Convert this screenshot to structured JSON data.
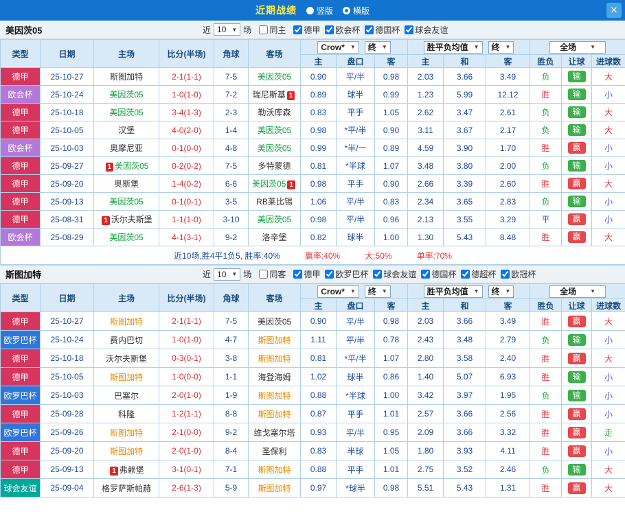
{
  "titlebar": {
    "title": "近期战绩",
    "radio_vertical": "竖版",
    "radio_horizontal": "横版",
    "selected_key": "radio_horizontal",
    "close_label": "✕"
  },
  "colors": {
    "accent_blue": "#1374d0",
    "league_colors": {
      "德甲": "#d6365e",
      "欧会杯": "#b478d8",
      "欧罗巴杯": "#3076d8",
      "球会友谊": "#00a79b"
    },
    "result": {
      "win": "#e5383d",
      "lose": "#1fa63c",
      "draw": "#3b5bd5",
      "push": "#1fa63c"
    },
    "handicap_badge": {
      "win": "#e5484d",
      "lose": "#3cb04c"
    },
    "goals": {
      "big": "#e5383d",
      "small": "#3b5bd5",
      "push": "#1fa63c"
    },
    "score_text": "#e02b2b",
    "odds_text": "#1a4a9e",
    "opponent_text": "#333333"
  },
  "sections": [
    {
      "team": "美因茨05",
      "team_color": "#09a23a",
      "filter": {
        "near_label": "近",
        "games_value": "10",
        "games_suffix": "场",
        "same_label": "同主",
        "same_checked": false,
        "leagues": [
          {
            "label": "德甲",
            "checked": true
          },
          {
            "label": "欧会杯",
            "checked": true
          },
          {
            "label": "德国杯",
            "checked": true
          },
          {
            "label": "球会友谊",
            "checked": true
          }
        ]
      },
      "header": {
        "type": "类型",
        "date": "日期",
        "home": "主场",
        "score": "比分(半场)",
        "corner": "角球",
        "away": "客场",
        "odds_source": "Crow*",
        "final1": "终",
        "col_home": "主",
        "col_handicap": "盘口",
        "col_away": "客",
        "euro_avg": "胜平负均值",
        "final2": "终",
        "col_win": "主",
        "col_draw": "和",
        "col_lose": "客",
        "scope": "全场",
        "col_result": "胜负",
        "col_hresult": "让球",
        "col_goals": "进球数"
      },
      "rows": [
        {
          "league": "德甲",
          "date": "25-10-27",
          "home": {
            "name": "斯图加特",
            "self": false
          },
          "score": "2-1(1-1)",
          "corner": "7-5",
          "away": {
            "name": "美因茨05",
            "self": true
          },
          "odds": [
            "0.90",
            "平/半",
            "0.98"
          ],
          "euro": [
            "2.03",
            "3.66",
            "3.49"
          ],
          "result": {
            "text": "负",
            "style": "lose"
          },
          "handicap": {
            "text": "输",
            "style": "lose"
          },
          "goals": {
            "text": "大",
            "style": "big"
          }
        },
        {
          "league": "欧会杯",
          "date": "25-10-24",
          "home": {
            "name": "美因茨05",
            "self": true
          },
          "score": "1-0(1-0)",
          "corner": "7-2",
          "away": {
            "name": "瑞尼斯基",
            "self": false,
            "card_after": "1"
          },
          "odds": [
            "0.89",
            "球半",
            "0.99"
          ],
          "euro": [
            "1.23",
            "5.99",
            "12.12"
          ],
          "result": {
            "text": "胜",
            "style": "win"
          },
          "handicap": {
            "text": "输",
            "style": "lose"
          },
          "goals": {
            "text": "小",
            "style": "small"
          }
        },
        {
          "league": "德甲",
          "date": "25-10-18",
          "home": {
            "name": "美因茨05",
            "self": true
          },
          "score": "3-4(1-3)",
          "corner": "2-3",
          "away": {
            "name": "勒沃库森",
            "self": false
          },
          "odds": [
            "0.83",
            "平手",
            "1.05"
          ],
          "euro": [
            "2.62",
            "3.47",
            "2.61"
          ],
          "result": {
            "text": "负",
            "style": "lose"
          },
          "handicap": {
            "text": "输",
            "style": "lose"
          },
          "goals": {
            "text": "大",
            "style": "big"
          }
        },
        {
          "league": "德甲",
          "date": "25-10-05",
          "home": {
            "name": "汉堡",
            "self": false
          },
          "score": "4-0(2-0)",
          "corner": "1-4",
          "away": {
            "name": "美因茨05",
            "self": true
          },
          "odds": [
            "0.98",
            "*平/半",
            "0.90"
          ],
          "euro": [
            "3.11",
            "3.67",
            "2.17"
          ],
          "result": {
            "text": "负",
            "style": "lose"
          },
          "handicap": {
            "text": "输",
            "style": "lose"
          },
          "goals": {
            "text": "大",
            "style": "big"
          }
        },
        {
          "league": "欧会杯",
          "date": "25-10-03",
          "home": {
            "name": "奥摩尼亚",
            "self": false
          },
          "score": "0-1(0-0)",
          "corner": "4-8",
          "away": {
            "name": "美因茨05",
            "self": true
          },
          "odds": [
            "0.99",
            "*半/一",
            "0.89"
          ],
          "euro": [
            "4.59",
            "3.90",
            "1.70"
          ],
          "result": {
            "text": "胜",
            "style": "win"
          },
          "handicap": {
            "text": "赢",
            "style": "win"
          },
          "goals": {
            "text": "小",
            "style": "small"
          }
        },
        {
          "league": "德甲",
          "date": "25-09-27",
          "home": {
            "name": "美因茨05",
            "self": true,
            "card_before": "1"
          },
          "score": "0-2(0-2)",
          "corner": "7-5",
          "away": {
            "name": "多特蒙德",
            "self": false
          },
          "odds": [
            "0.81",
            "*半球",
            "1.07"
          ],
          "euro": [
            "3.48",
            "3.80",
            "2.00"
          ],
          "result": {
            "text": "负",
            "style": "lose"
          },
          "handicap": {
            "text": "输",
            "style": "lose"
          },
          "goals": {
            "text": "小",
            "style": "small"
          }
        },
        {
          "league": "德甲",
          "date": "25-09-20",
          "home": {
            "name": "奥斯堡",
            "self": false
          },
          "score": "1-4(0-2)",
          "corner": "6-6",
          "away": {
            "name": "美因茨05",
            "self": true,
            "card_after": "1"
          },
          "odds": [
            "0.98",
            "平手",
            "0.90"
          ],
          "euro": [
            "2.66",
            "3.39",
            "2.60"
          ],
          "result": {
            "text": "胜",
            "style": "win"
          },
          "handicap": {
            "text": "赢",
            "style": "win"
          },
          "goals": {
            "text": "大",
            "style": "big"
          }
        },
        {
          "league": "德甲",
          "date": "25-09-13",
          "home": {
            "name": "美因茨05",
            "self": true
          },
          "score": "0-1(0-1)",
          "corner": "3-5",
          "away": {
            "name": "RB莱比锡",
            "self": false
          },
          "odds": [
            "1.06",
            "平/半",
            "0.83"
          ],
          "euro": [
            "2.34",
            "3.65",
            "2.83"
          ],
          "result": {
            "text": "负",
            "style": "lose"
          },
          "handicap": {
            "text": "输",
            "style": "lose"
          },
          "goals": {
            "text": "小",
            "style": "small"
          }
        },
        {
          "league": "德甲",
          "date": "25-08-31",
          "home": {
            "name": "沃尔夫斯堡",
            "self": false,
            "card_before": "1"
          },
          "score": "1-1(1-0)",
          "corner": "3-10",
          "away": {
            "name": "美因茨05",
            "self": true
          },
          "odds": [
            "0.98",
            "平/半",
            "0.96"
          ],
          "euro": [
            "2.13",
            "3.55",
            "3.29"
          ],
          "result": {
            "text": "平",
            "style": "draw"
          },
          "handicap": {
            "text": "赢",
            "style": "win"
          },
          "goals": {
            "text": "小",
            "style": "small"
          }
        },
        {
          "league": "欧会杯",
          "date": "25-08-29",
          "home": {
            "name": "美因茨05",
            "self": true
          },
          "score": "4-1(3-1)",
          "corner": "9-2",
          "away": {
            "name": "洛辛堡",
            "self": false
          },
          "odds": [
            "0.82",
            "球半",
            "1.00"
          ],
          "euro": [
            "1.30",
            "5.43",
            "8.48"
          ],
          "result": {
            "text": "胜",
            "style": "win"
          },
          "handicap": {
            "text": "赢",
            "style": "win"
          },
          "goals": {
            "text": "大",
            "style": "big"
          }
        }
      ],
      "summary": [
        {
          "text": "近10场,胜4平1负5, 胜率:40%",
          "color": "#1a4a9e"
        },
        {
          "text": "赢率:40%",
          "color": "#e5383d"
        },
        {
          "text": "大:50%",
          "color": "#e5383d"
        },
        {
          "text": "单率:70%",
          "color": "#e5383d"
        }
      ]
    },
    {
      "team": "斯图加特",
      "team_color": "#ef8a00",
      "filter": {
        "near_label": "近",
        "games_value": "10",
        "games_suffix": "场",
        "same_label": "同客",
        "same_checked": false,
        "leagues": [
          {
            "label": "德甲",
            "checked": true
          },
          {
            "label": "欧罗巴杯",
            "checked": true
          },
          {
            "label": "球会友谊",
            "checked": true
          },
          {
            "label": "德国杯",
            "checked": true
          },
          {
            "label": "德超杯",
            "checked": true
          },
          {
            "label": "欧冠杯",
            "checked": true
          }
        ]
      },
      "header": {
        "type": "类型",
        "date": "日期",
        "home": "主场",
        "score": "比分(半场)",
        "corner": "角球",
        "away": "客场",
        "odds_source": "Crow*",
        "final1": "终",
        "col_home": "主",
        "col_handicap": "盘口",
        "col_away": "客",
        "euro_avg": "胜平负均值",
        "final2": "终",
        "col_win": "主",
        "col_draw": "和",
        "col_lose": "客",
        "scope": "全场",
        "col_result": "胜负",
        "col_hresult": "让球",
        "col_goals": "进球数"
      },
      "rows": [
        {
          "league": "德甲",
          "date": "25-10-27",
          "home": {
            "name": "斯图加特",
            "self": true
          },
          "score": "2-1(1-1)",
          "corner": "7-5",
          "away": {
            "name": "美因茨05",
            "self": false
          },
          "odds": [
            "0.90",
            "平/半",
            "0.98"
          ],
          "euro": [
            "2.03",
            "3.66",
            "3.49"
          ],
          "result": {
            "text": "胜",
            "style": "win"
          },
          "handicap": {
            "text": "赢",
            "style": "win"
          },
          "goals": {
            "text": "大",
            "style": "big"
          }
        },
        {
          "league": "欧罗巴杯",
          "date": "25-10-24",
          "home": {
            "name": "费内巴切",
            "self": false
          },
          "score": "1-0(1-0)",
          "corner": "4-7",
          "away": {
            "name": "斯图加特",
            "self": true
          },
          "odds": [
            "1.11",
            "平/半",
            "0.78"
          ],
          "euro": [
            "2.43",
            "3.48",
            "2.79"
          ],
          "result": {
            "text": "负",
            "style": "lose"
          },
          "handicap": {
            "text": "输",
            "style": "lose"
          },
          "goals": {
            "text": "小",
            "style": "small"
          }
        },
        {
          "league": "德甲",
          "date": "25-10-18",
          "home": {
            "name": "沃尔夫斯堡",
            "self": false
          },
          "score": "0-3(0-1)",
          "corner": "3-8",
          "away": {
            "name": "斯图加特",
            "self": true
          },
          "odds": [
            "0.81",
            "*平/半",
            "1.07"
          ],
          "euro": [
            "2.80",
            "3.58",
            "2.40"
          ],
          "result": {
            "text": "胜",
            "style": "win"
          },
          "handicap": {
            "text": "赢",
            "style": "win"
          },
          "goals": {
            "text": "大",
            "style": "big"
          }
        },
        {
          "league": "德甲",
          "date": "25-10-05",
          "home": {
            "name": "斯图加特",
            "self": true
          },
          "score": "1-0(0-0)",
          "corner": "1-1",
          "away": {
            "name": "海登海姆",
            "self": false
          },
          "odds": [
            "1.02",
            "球半",
            "0.86"
          ],
          "euro": [
            "1.40",
            "5.07",
            "6.93"
          ],
          "result": {
            "text": "胜",
            "style": "win"
          },
          "handicap": {
            "text": "输",
            "style": "lose"
          },
          "goals": {
            "text": "小",
            "style": "small"
          }
        },
        {
          "league": "欧罗巴杯",
          "date": "25-10-03",
          "home": {
            "name": "巴塞尔",
            "self": false
          },
          "score": "2-0(1-0)",
          "corner": "1-9",
          "away": {
            "name": "斯图加特",
            "self": true
          },
          "odds": [
            "0.88",
            "*半球",
            "1.00"
          ],
          "euro": [
            "3.42",
            "3.97",
            "1.95"
          ],
          "result": {
            "text": "负",
            "style": "lose"
          },
          "handicap": {
            "text": "输",
            "style": "lose"
          },
          "goals": {
            "text": "小",
            "style": "small"
          }
        },
        {
          "league": "德甲",
          "date": "25-09-28",
          "home": {
            "name": "科隆",
            "self": false
          },
          "score": "1-2(1-1)",
          "corner": "8-8",
          "away": {
            "name": "斯图加特",
            "self": true
          },
          "odds": [
            "0.87",
            "平手",
            "1.01"
          ],
          "euro": [
            "2.57",
            "3.66",
            "2.56"
          ],
          "result": {
            "text": "胜",
            "style": "win"
          },
          "handicap": {
            "text": "赢",
            "style": "win"
          },
          "goals": {
            "text": "小",
            "style": "small"
          }
        },
        {
          "league": "欧罗巴杯",
          "date": "25-09-26",
          "home": {
            "name": "斯图加特",
            "self": true
          },
          "score": "2-1(0-0)",
          "corner": "9-2",
          "away": {
            "name": "维戈塞尔塔",
            "self": false
          },
          "odds": [
            "0.93",
            "平/半",
            "0.95"
          ],
          "euro": [
            "2.09",
            "3.66",
            "3.32"
          ],
          "result": {
            "text": "胜",
            "style": "win"
          },
          "handicap": {
            "text": "赢",
            "style": "win"
          },
          "goals": {
            "text": "走",
            "style": "push"
          }
        },
        {
          "league": "德甲",
          "date": "25-09-20",
          "home": {
            "name": "斯图加特",
            "self": true
          },
          "score": "2-0(1-0)",
          "corner": "8-4",
          "away": {
            "name": "圣保利",
            "self": false
          },
          "odds": [
            "0.83",
            "半球",
            "1.05"
          ],
          "euro": [
            "1.80",
            "3.93",
            "4.11"
          ],
          "result": {
            "text": "胜",
            "style": "win"
          },
          "handicap": {
            "text": "赢",
            "style": "win"
          },
          "goals": {
            "text": "小",
            "style": "small"
          }
        },
        {
          "league": "德甲",
          "date": "25-09-13",
          "home": {
            "name": "弗赖堡",
            "self": false,
            "card_before": "1"
          },
          "score": "3-1(0-1)",
          "corner": "7-1",
          "away": {
            "name": "斯图加特",
            "self": true
          },
          "odds": [
            "0.88",
            "平手",
            "1.01"
          ],
          "euro": [
            "2.75",
            "3.52",
            "2.46"
          ],
          "result": {
            "text": "负",
            "style": "lose"
          },
          "handicap": {
            "text": "输",
            "style": "lose"
          },
          "goals": {
            "text": "大",
            "style": "big"
          }
        },
        {
          "league": "球会友谊",
          "date": "25-09-04",
          "home": {
            "name": "格罗萨斯帕赫",
            "self": false
          },
          "score": "2-6(1-3)",
          "corner": "5-9",
          "away": {
            "name": "斯图加特",
            "self": true
          },
          "odds": [
            "0.97",
            "*球半",
            "0.98"
          ],
          "euro": [
            "5.51",
            "5.43",
            "1.31"
          ],
          "result": {
            "text": "胜",
            "style": "win"
          },
          "handicap": {
            "text": "赢",
            "style": "win"
          },
          "goals": {
            "text": "大",
            "style": "big"
          }
        }
      ],
      "summary": []
    }
  ]
}
